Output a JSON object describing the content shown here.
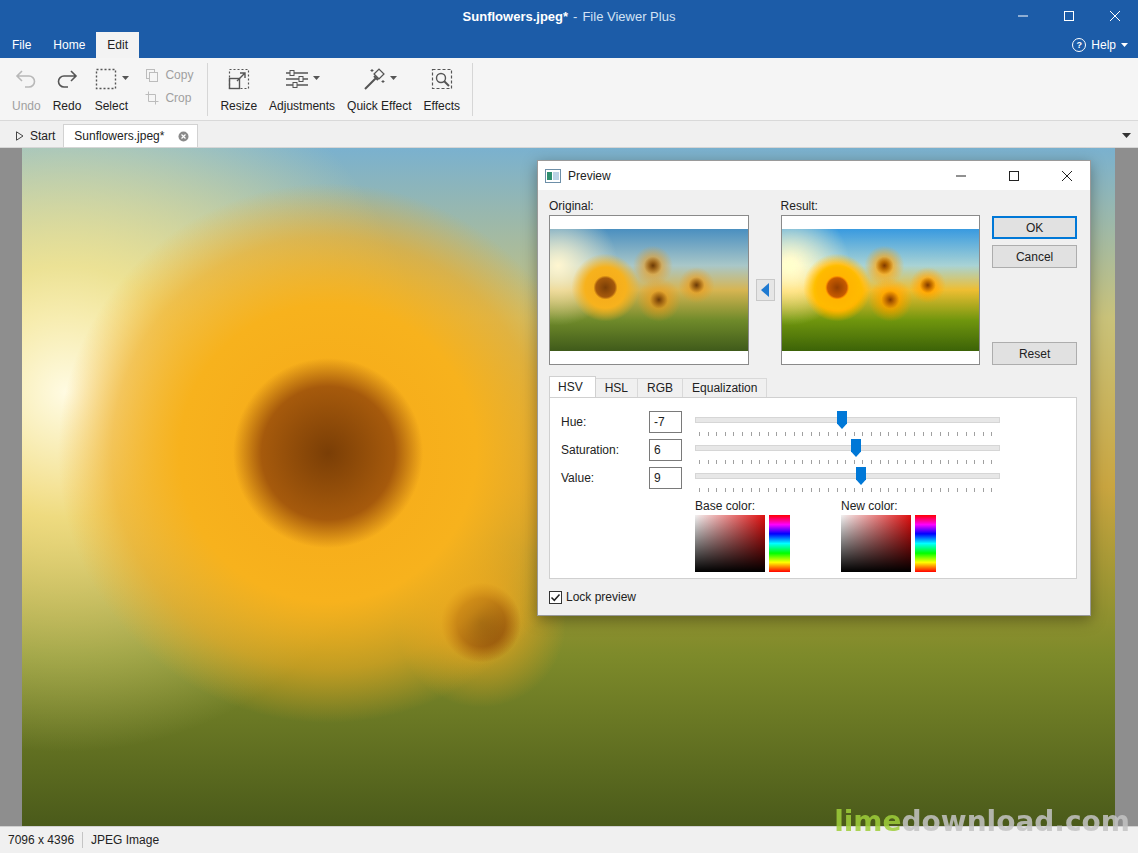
{
  "window": {
    "document": "Sunflowers.jpeg*",
    "separator": "-",
    "app": "File Viewer Plus"
  },
  "menu_tabs": [
    {
      "label": "File",
      "selected": false
    },
    {
      "label": "Home",
      "selected": false
    },
    {
      "label": "Edit",
      "selected": true
    }
  ],
  "help": {
    "icon": "?",
    "label": "Help"
  },
  "ribbon": [
    {
      "kind": "large",
      "label": "Undo",
      "disabled": true,
      "dropdown": false
    },
    {
      "kind": "large",
      "label": "Redo",
      "disabled": false,
      "dropdown": false
    },
    {
      "kind": "large",
      "label": "Select",
      "disabled": false,
      "dropdown": true
    },
    {
      "kind": "stack",
      "items": [
        {
          "label": "Copy",
          "disabled": true
        },
        {
          "label": "Crop",
          "disabled": true
        }
      ]
    },
    {
      "kind": "separator"
    },
    {
      "kind": "large",
      "label": "Resize",
      "disabled": false,
      "dropdown": false
    },
    {
      "kind": "large",
      "label": "Adjustments",
      "disabled": false,
      "dropdown": true
    },
    {
      "kind": "large",
      "label": "Quick Effect",
      "disabled": false,
      "dropdown": true
    },
    {
      "kind": "large",
      "label": "Effects",
      "disabled": false,
      "dropdown": false
    },
    {
      "kind": "separator"
    }
  ],
  "doc_tabs": [
    {
      "label": "Start",
      "selected": false,
      "closable": false
    },
    {
      "label": "Sunflowers.jpeg*",
      "selected": true,
      "closable": true
    }
  ],
  "status_bar": [
    "7096 x 4396",
    "JPEG Image"
  ],
  "dialog": {
    "title": "Preview",
    "original_label": "Original:",
    "result_label": "Result:",
    "actions": [
      {
        "label": "OK",
        "default": true
      },
      {
        "label": "Cancel",
        "default": false
      }
    ],
    "reset": {
      "label": "Reset"
    },
    "tabs": [
      {
        "label": "HSV",
        "selected": true
      },
      {
        "label": "HSL",
        "selected": false
      },
      {
        "label": "RGB",
        "selected": false
      },
      {
        "label": "Equalization",
        "selected": false
      }
    ],
    "rows": [
      {
        "label": "Hue:",
        "value": "-7",
        "level": 0.48
      },
      {
        "label": "Saturation:",
        "value": "6",
        "level": 0.53
      },
      {
        "label": "Value:",
        "value": "9",
        "level": 0.545
      }
    ],
    "colors": [
      {
        "label": "Base color:"
      },
      {
        "label": "New color:"
      }
    ],
    "lock": {
      "label": "Lock preview",
      "checked": true
    }
  },
  "watermark": [
    {
      "text": "lime",
      "color": "#9fcf3a"
    },
    {
      "text": "download.com",
      "color": "#c4c4c4"
    }
  ]
}
